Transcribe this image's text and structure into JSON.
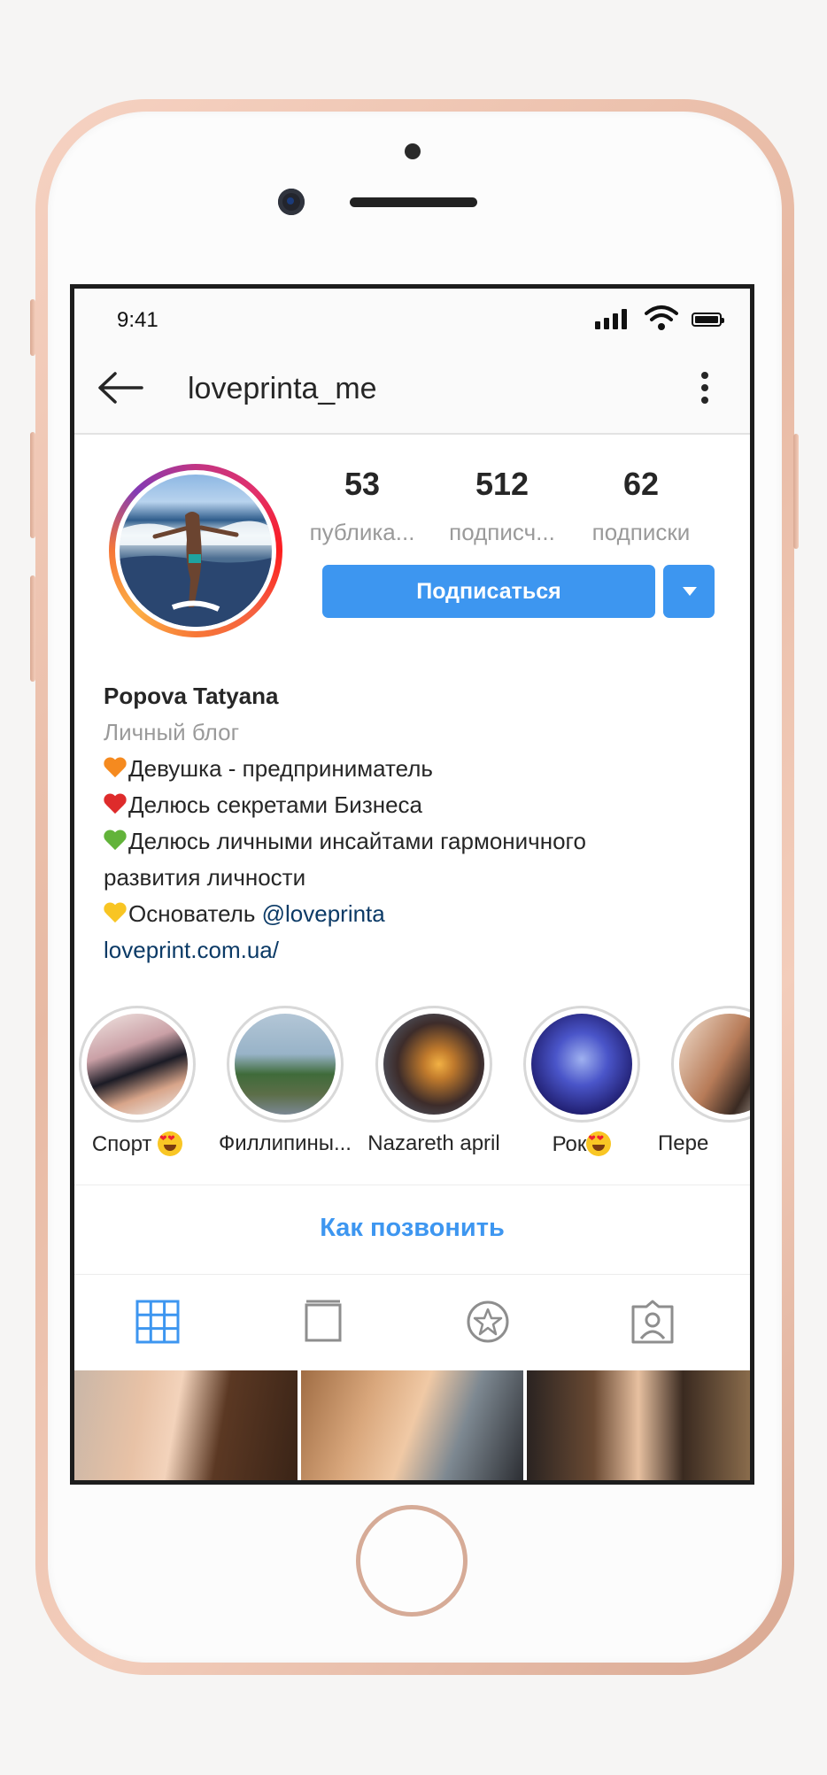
{
  "status_bar": {
    "time": "9:41"
  },
  "header": {
    "username": "loveprinta_me"
  },
  "stats": [
    {
      "value": "53",
      "label": "публика..."
    },
    {
      "value": "512",
      "label": "подписч..."
    },
    {
      "value": "62",
      "label": "подписки"
    }
  ],
  "actions": {
    "follow_label": "Подписаться"
  },
  "bio": {
    "name": "Popova Tatyana",
    "category": "Личный блог",
    "line1": "Девушка - предприниматель",
    "line2": "Делюсь секретами Бизнеса",
    "line3": "Делюсь личными инсайтами гармоничного",
    "line3b": "развития личности",
    "line4_prefix": "Основатель ",
    "line4_mention": "@loveprinta",
    "website": "loveprint.com.ua/"
  },
  "highlights": [
    {
      "label": "Спорт "
    },
    {
      "label": "Филлипины..."
    },
    {
      "label": "Nazareth april"
    },
    {
      "label": "Рок"
    },
    {
      "label": "Пере"
    }
  ],
  "contact": {
    "call_label": "Как позвонить"
  },
  "colors": {
    "accent": "#3d96f0",
    "text": "#262626",
    "muted": "#9a9a9a"
  },
  "icons": [
    "back-arrow-icon",
    "more-vertical-icon",
    "grid-icon",
    "feed-icon",
    "igtv-star-icon",
    "tagged-icon"
  ]
}
